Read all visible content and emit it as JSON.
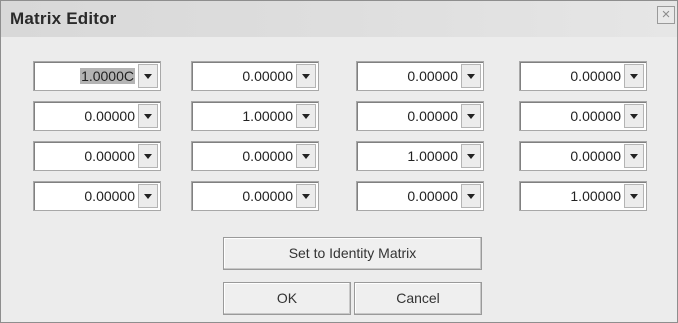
{
  "window": {
    "title": "Matrix Editor",
    "close_label": "×"
  },
  "matrix": {
    "rows": [
      [
        "1.00000",
        "0.00000",
        "0.00000",
        "0.00000"
      ],
      [
        "0.00000",
        "1.00000",
        "0.00000",
        "0.00000"
      ],
      [
        "0.00000",
        "0.00000",
        "1.00000",
        "0.00000"
      ],
      [
        "0.00000",
        "0.00000",
        "0.00000",
        "1.00000"
      ]
    ],
    "selected_cell_display": "1.0000C"
  },
  "buttons": {
    "identity_label": "Set to Identity Matrix",
    "ok_label": "OK",
    "cancel_label": "Cancel"
  },
  "icons": {
    "dropdown": "chevron-down-icon",
    "close": "close-icon"
  }
}
